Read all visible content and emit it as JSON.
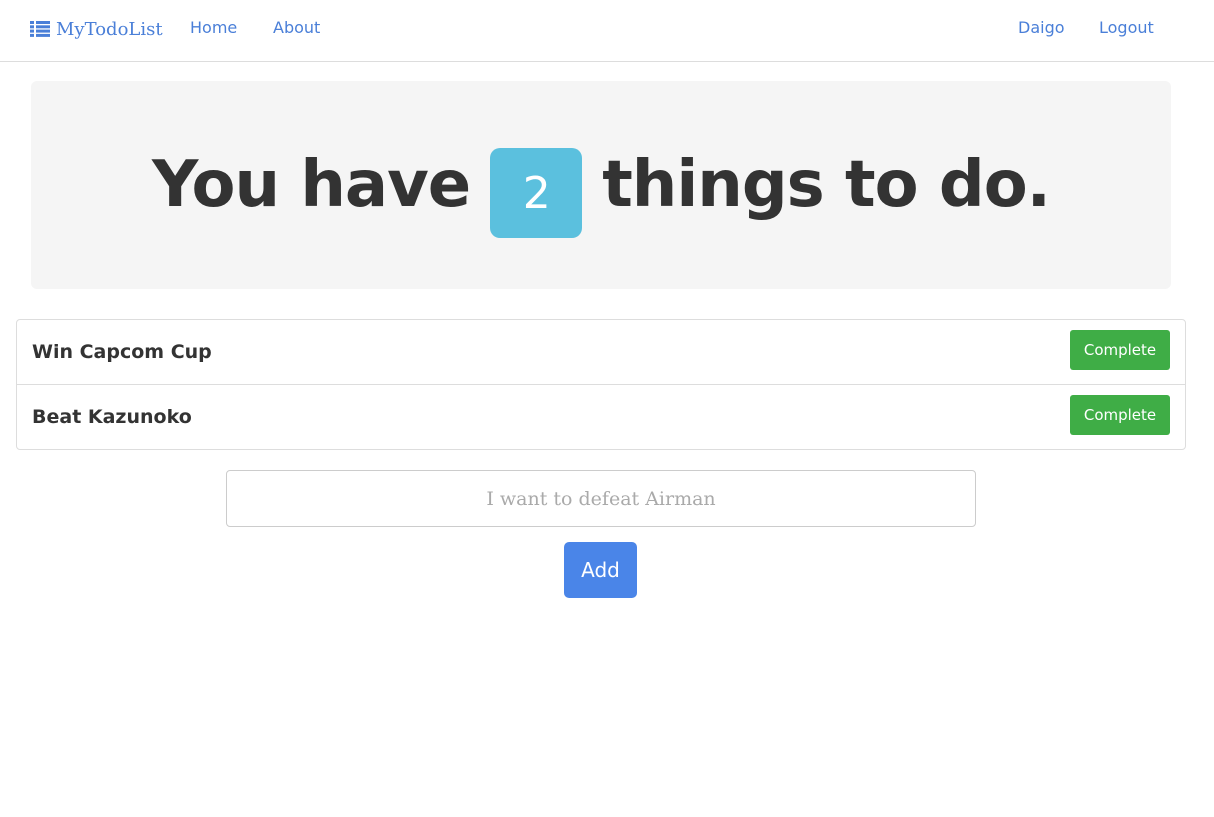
{
  "navbar": {
    "brand": "MyTodoList",
    "brand_icon": "list-icon",
    "links": {
      "home": "Home",
      "about": "About",
      "user": "Daigo",
      "logout": "Logout"
    },
    "link_color": "#4a7fd8"
  },
  "jumbotron": {
    "prefix": "You have",
    "count": "2",
    "suffix": "things to do.",
    "badge_color": "#5bc0de"
  },
  "todos": [
    {
      "title": "Win Capcom Cup",
      "action": "Complete"
    },
    {
      "title": "Beat Kazunoko",
      "action": "Complete"
    }
  ],
  "form": {
    "placeholder": "I want to defeat Airman",
    "value": "",
    "add_label": "Add",
    "add_color": "#4a85e8",
    "complete_color": "#3fad46"
  }
}
